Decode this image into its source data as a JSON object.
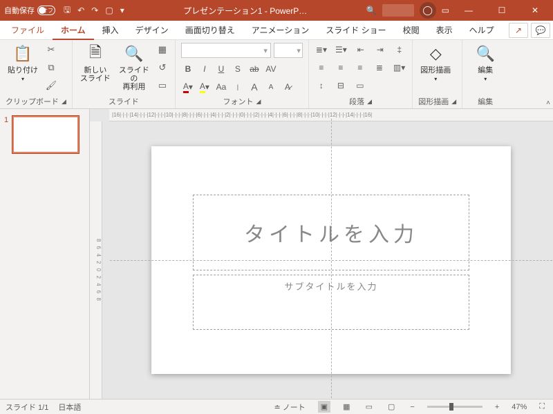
{
  "titlebar": {
    "autosave_label": "自動保存",
    "autosave_off": "オフ",
    "title": "プレゼンテーション1 - PowerP…"
  },
  "tabs": {
    "file": "ファイル",
    "home": "ホーム",
    "insert": "挿入",
    "design": "デザイン",
    "transitions": "画面切り替え",
    "animations": "アニメーション",
    "slideshow": "スライド ショー",
    "review": "校閲",
    "view": "表示",
    "help": "ヘルプ"
  },
  "ribbon": {
    "clipboard": {
      "paste": "貼り付け",
      "label": "クリップボード"
    },
    "slides": {
      "new_slide": "新しい\nスライド",
      "reuse": "スライドの\n再利用",
      "label": "スライド"
    },
    "font": {
      "label": "フォント",
      "B": "B",
      "I": "I",
      "U": "U",
      "S": "S",
      "ab": "ab",
      "AV": "AV",
      "Aa": "Aa",
      "Abig": "A",
      "Asmall": "A"
    },
    "paragraph": {
      "label": "段落"
    },
    "drawing": {
      "shapes": "図形描画",
      "label": "図形描画"
    },
    "editing": {
      "edit": "編集",
      "label": "編集"
    }
  },
  "thumbs": {
    "n1": "1"
  },
  "slide": {
    "title_ph": "タイトルを入力",
    "subtitle_ph": "サブタイトルを入力"
  },
  "ruler_h": "|16|·|·|·|14|·|·|·|12|·|·|·|10|·|·|·|8|·|·|·|6|·|·|·|4|·|·|·|2|·|·|·|0|·|·|·|2|·|·|·|4|·|·|·|6|·|·|·|8|·|·|·|10|·|·|·|12|·|·|·|14|·|·|·|16|",
  "ruler_v": "8 6 4 2 0 2 4 6 8",
  "status": {
    "slide": "スライド 1/1",
    "lang": "日本語",
    "notes": "ノート",
    "zoom": "47%"
  }
}
